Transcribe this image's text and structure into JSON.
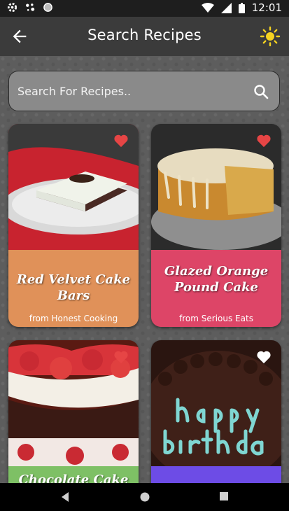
{
  "status": {
    "time": "12:01"
  },
  "header": {
    "title": "Search Recipes"
  },
  "search": {
    "placeholder": "Search For Recipes.."
  },
  "recipes": [
    {
      "name": "Red Velvet Cake Bars",
      "source": "from Honest Cooking",
      "band_color": "#e09159",
      "favorite": true
    },
    {
      "name": "Glazed Orange Pound Cake",
      "source": "from Serious Eats",
      "band_color": "#dd4567",
      "favorite": true
    },
    {
      "name": "Chocolate Cake with",
      "source": "",
      "band_color": "#7ec065",
      "favorite": true
    },
    {
      "name": "",
      "source": "",
      "band_color": "#6d4ce6",
      "favorite": false
    }
  ],
  "colors": {
    "favorite": "#e64545",
    "not_favorite": "#ffffff",
    "sun": "#f5d320"
  }
}
